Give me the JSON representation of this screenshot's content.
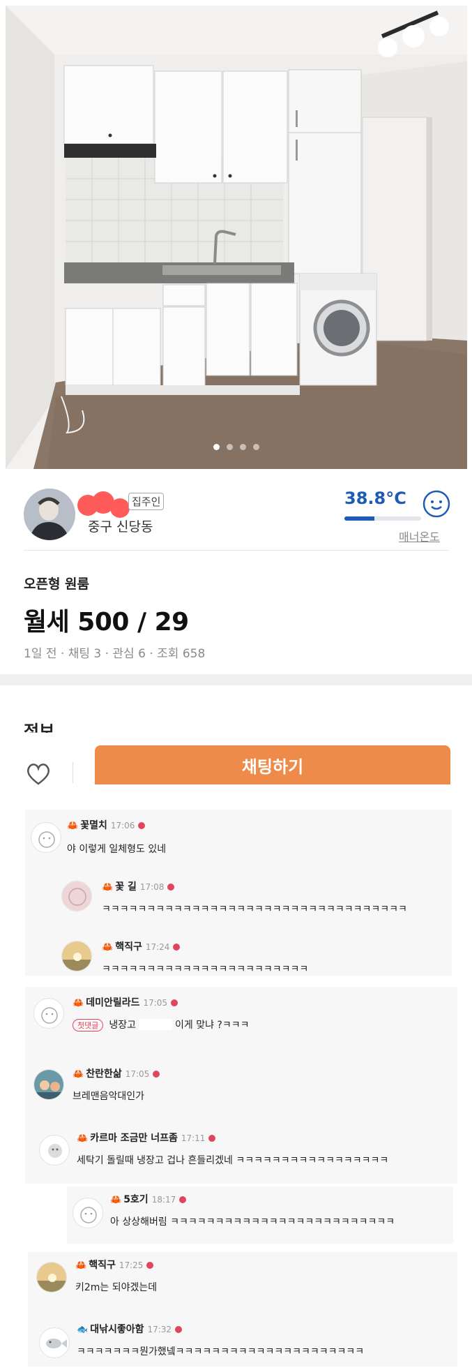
{
  "photo": {
    "dots": 4,
    "active_dot": 1
  },
  "seller": {
    "role_badge": "집주인",
    "location": "중구 신당동",
    "temperature": "38.8°C",
    "temperature_fraction": 0.39,
    "manner_label": "매너온도",
    "accent": "#1d5bb5"
  },
  "listing": {
    "category": "오픈형 원룸",
    "price": "월세 500 / 29",
    "meta": "1일 전 · 채팅 3 · 관심 6 · 조회 658",
    "section_title": "정보"
  },
  "bottom_bar": {
    "chat_button": "채팅하기",
    "chat_color": "#ee8b4b"
  },
  "comments": [
    {
      "nick": "꽃멸치",
      "time": "17:06",
      "text": "야 이렇게 일체형도 있네"
    },
    {
      "nick": "꽃 길",
      "time": "17:08",
      "text": "ㅋㅋㅋㅋㅋㅋㅋㅋㅋㅋㅋㅋㅋㅋㅋㅋㅋㅋㅋㅋㅋㅋㅋㅋㅋㅋㅋㅋㅋㅋㅋㅋㅋㅋ"
    },
    {
      "nick": "핵직구",
      "time": "17:24",
      "text": "ㅋㅋㅋㅋㅋㅋㅋㅋㅋㅋㅋㅋㅋㅋㅋㅋㅋㅋㅋㅋㅋㅋㅋ"
    },
    {
      "nick": "데미안릴라드",
      "time": "17:05",
      "tag": "첫댓글",
      "text_a": "냉장고",
      "text_b": "이게 맞냐 ?ㅋㅋㅋ"
    },
    {
      "nick": "찬란한삶",
      "time": "17:05",
      "text": "브레맨음악대인가"
    },
    {
      "nick": "카르마 조금만 너프좀",
      "time": "17:11",
      "text": "세탁기 돌릴때 냉장고 겁나 흔들리겠네 ㅋㅋㅋㅋㅋㅋㅋㅋㅋㅋㅋㅋㅋㅋㅋㅋㅋ"
    },
    {
      "nick": "5호기",
      "time": "18:17",
      "text": "아 상상해버림 ㅋㅋㅋㅋㅋㅋㅋㅋㅋㅋㅋㅋㅋㅋㅋㅋㅋㅋㅋㅋㅋㅋㅋㅋㅋ"
    },
    {
      "nick": "핵직구",
      "time": "17:25",
      "text": "키2m는 되야겠는데"
    },
    {
      "nick": "대낚시좋아함",
      "time": "17:32",
      "text": "ㅋㅋㅋㅋㅋㅋㅋ뭔가했넼ㅋㅋㅋㅋㅋㅋㅋㅋㅋㅋㅋㅋㅋㅋㅋㅋㅋㅋㅋㅋㅋ"
    }
  ]
}
